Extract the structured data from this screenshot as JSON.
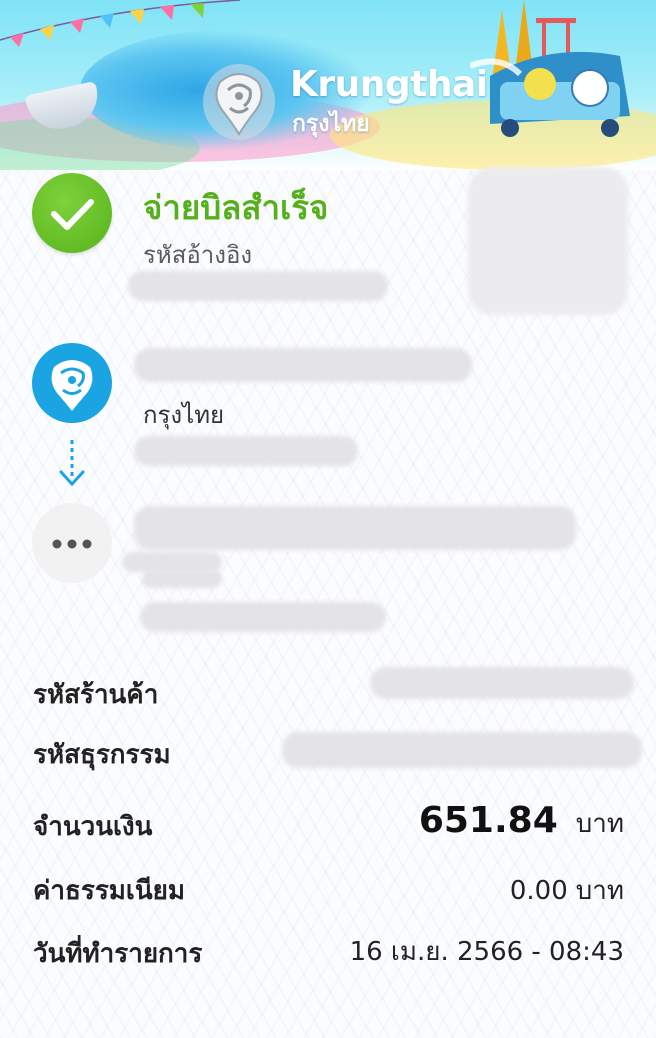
{
  "banner": {
    "brand_en": "Krungthai",
    "brand_th": "กรุงไทย",
    "logo_icon": "krungthai-phoenix-logo",
    "theme": "songkran-festival"
  },
  "status": {
    "icon": "checkmark-icon",
    "title": "จ่ายบิลสำเร็จ",
    "reference_label": "รหัสอ้างอิง"
  },
  "transfer": {
    "from_bank": "กรุงไทย",
    "from_icon": "krungthai-logo-icon",
    "arrow_icon": "arrow-down-icon",
    "to_icon": "more-dots-icon"
  },
  "details": {
    "merchant_id_label": "รหัสร้านค้า",
    "transaction_id_label": "รหัสธุรกรรม",
    "amount_label": "จำนวนเงิน",
    "amount_value": "651.84",
    "amount_unit": "บาท",
    "fee_label": "ค่าธรรมเนียม",
    "fee_value": "0.00",
    "fee_unit": "บาท",
    "date_label": "วันที่ทำรายการ",
    "date_value": "16 เม.ย. 2566 - 08:43"
  },
  "colors": {
    "success_green": "#55b01a",
    "brand_blue": "#1ba4e2",
    "banner_cyan": "#7fe3f6"
  }
}
